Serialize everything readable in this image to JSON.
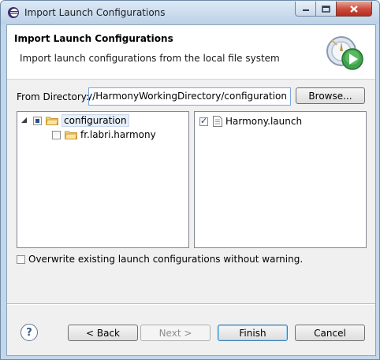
{
  "window": {
    "title": "Import Launch Configurations"
  },
  "banner": {
    "title": "Import Launch Configurations",
    "description": "Import launch configurations from the local file system"
  },
  "directory": {
    "label": "From Directory:",
    "value": "onnie/HarmonyWorkingDirectory/configuration",
    "visible_value": "ıony/HarmonyWorkingDirectory/configuration",
    "browse_label": "Browse..."
  },
  "folders": [
    {
      "label": "configuration",
      "checked": "partial",
      "expanded": true
    },
    {
      "label": "fr.labri.harmony",
      "checked": "unchecked"
    }
  ],
  "files": [
    {
      "label": "Harmony.launch",
      "checked": "checked"
    }
  ],
  "overwrite": {
    "label": "Overwrite existing launch configurations without warning.",
    "checked": false
  },
  "buttons": {
    "back": "< Back",
    "next": "Next >",
    "finish": "Finish",
    "cancel": "Cancel",
    "help": "?"
  },
  "icons": {
    "app": "eclipse-icon",
    "banner": "launch-configuration-icon",
    "folder": "folder-icon",
    "file": "file-icon"
  }
}
